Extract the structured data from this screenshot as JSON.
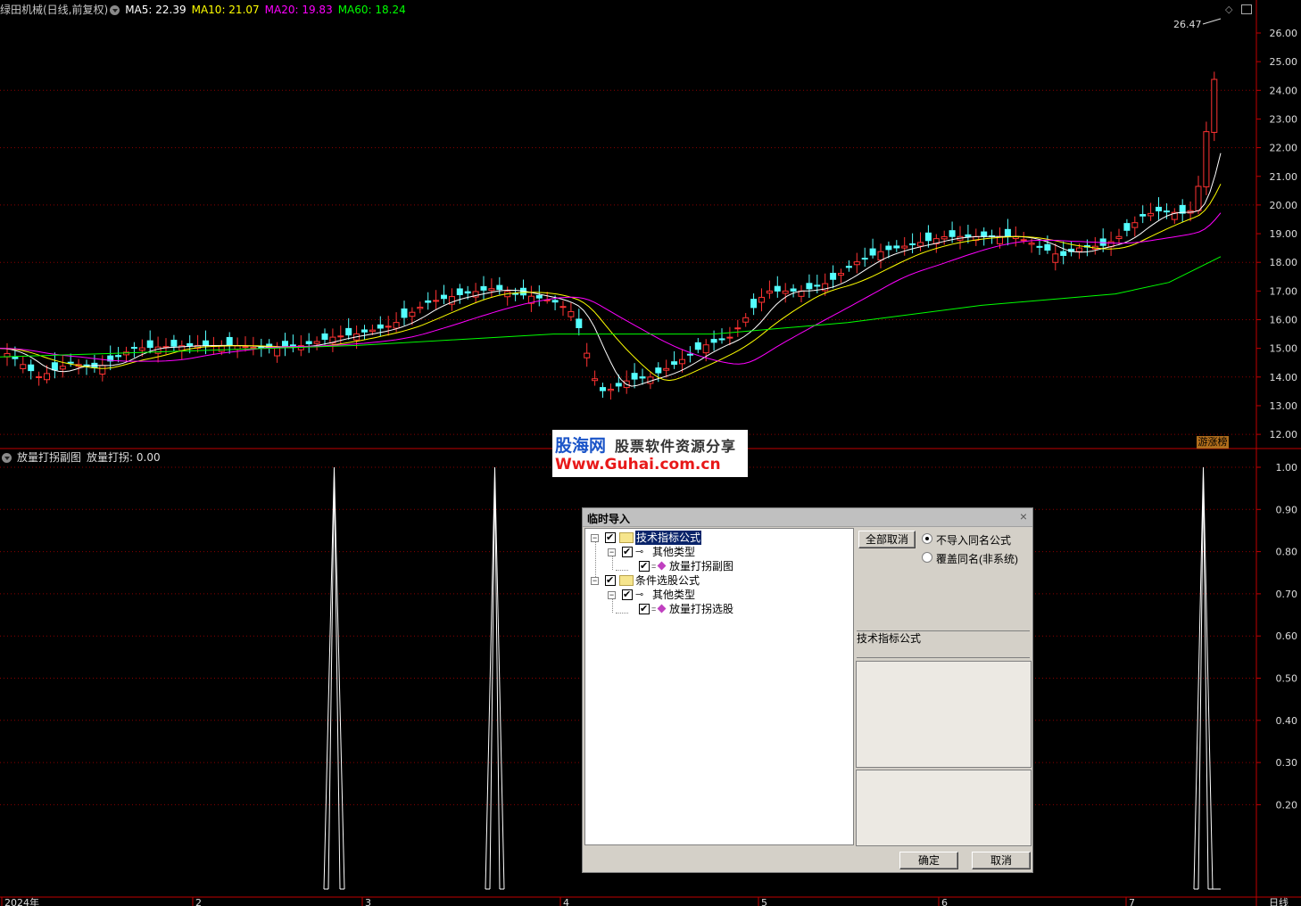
{
  "main": {
    "stock_title": "绿田机械(日线,前复权)",
    "ma5": "MA5: 22.39",
    "ma10": "MA10: 21.07",
    "ma20": "MA20: 19.83",
    "ma60": "MA60: 18.24",
    "peak_label": "26.47",
    "badge": "游涨榜",
    "price_ticks": [
      "26.00",
      "25.00",
      "24.00",
      "23.00",
      "22.00",
      "21.00",
      "20.00",
      "19.00",
      "18.00",
      "17.00",
      "16.00",
      "15.00",
      "14.00",
      "13.00",
      "12.00"
    ],
    "colors": {
      "ma5": "#ffffff",
      "ma10": "#ffff00",
      "ma20": "#ff00ff",
      "ma60": "#00ff00",
      "up": "#ff3232",
      "down": "#54ffff",
      "grid": "#8b0000",
      "axis": "#c00000"
    }
  },
  "sub": {
    "indicator_title": "放量打拐副图",
    "indicator_value": "放量打拐: 0.00",
    "ticks": [
      "1.00",
      "0.90",
      "0.80",
      "0.70",
      "0.60",
      "0.50",
      "0.40",
      "0.30",
      "0.20"
    ]
  },
  "xaxis": {
    "labels": [
      "2024年",
      "2",
      "3",
      "4",
      "5",
      "6",
      "7"
    ],
    "period": "日线"
  },
  "watermark": {
    "brand": "股海网",
    "slogan": "股票软件资源分享",
    "url": "Www.Guhai.com.cn"
  },
  "dialog": {
    "title": "临时导入",
    "tree": {
      "group1": "技术指标公式",
      "group1_child": "其他类型",
      "group1_leaf": "放量打拐副图",
      "group2": "条件选股公式",
      "group2_child": "其他类型",
      "group2_leaf": "放量打拐选股"
    },
    "cancel_all": "全部取消",
    "radio1": "不导入同名公式",
    "radio2": "覆盖同名(非系统)",
    "category": "技术指标公式",
    "ok": "确定",
    "cancel": "取消"
  },
  "chart_data": {
    "type": "line",
    "title": "放量打拐: 0.00",
    "spikes": [
      {
        "x_position": "2月末",
        "value": 1.0
      },
      {
        "x_position": "3月下旬",
        "value": 1.0
      },
      {
        "x_position": "7月中旬",
        "value": 1.0
      }
    ],
    "ylim": [
      0,
      1.0
    ]
  }
}
